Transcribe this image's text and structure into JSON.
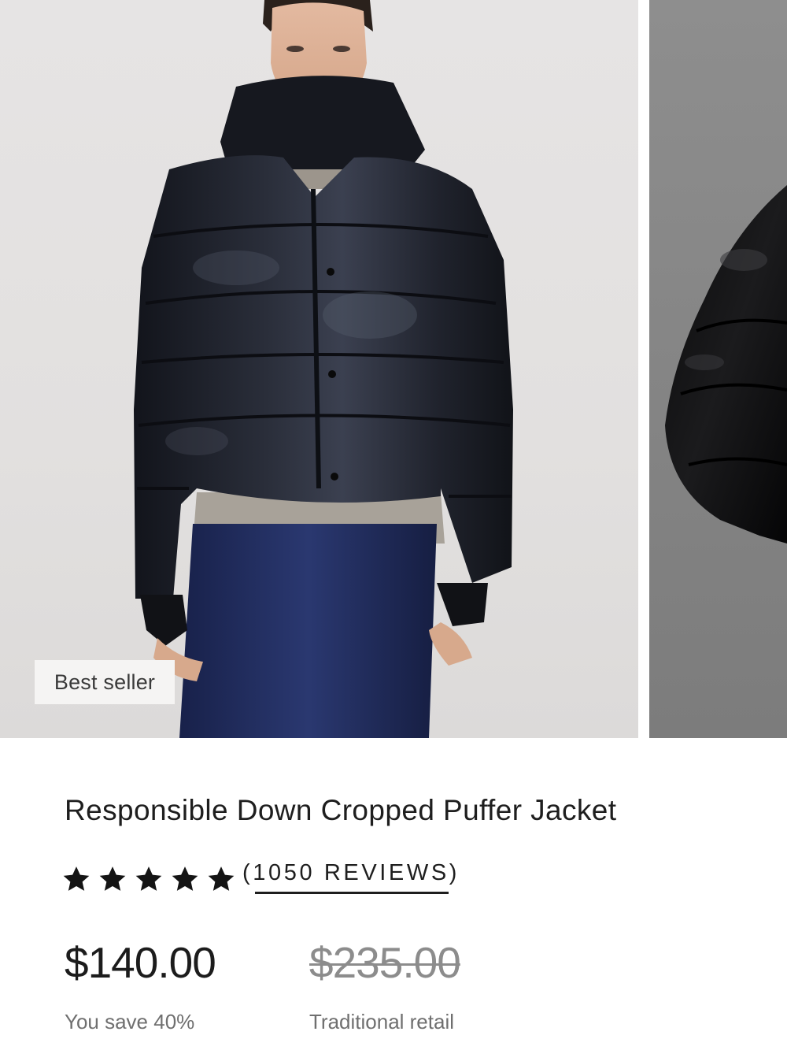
{
  "carousel": {
    "badge": "Best seller",
    "images": [
      {
        "icon": "model-wearing-black-puffer-jacket-photo"
      },
      {
        "icon": "black-puffer-jacket-detail-photo"
      }
    ]
  },
  "product": {
    "title": "Responsible Down Cropped Puffer Jacket",
    "rating": {
      "stars": 5,
      "reviews_label": "(1050 REVIEWS)"
    },
    "price": "$140.00",
    "savings": "You save 40%",
    "retail_price": "$235.00",
    "retail_label": "Traditional retail"
  },
  "colors": {
    "text": "#1e1e1e",
    "muted": "#6f6f6f",
    "strike": "#8c8c8c",
    "jacket": "#1c1f2a",
    "skirt": "#1f2a55"
  }
}
